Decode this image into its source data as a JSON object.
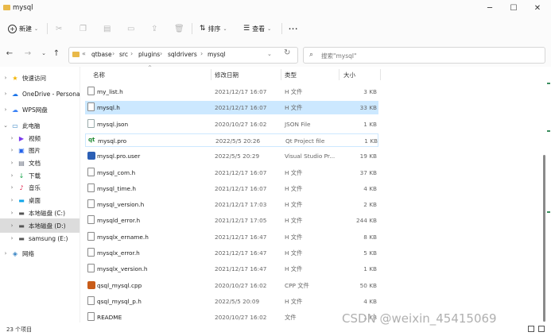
{
  "window": {
    "title": "mysql",
    "controls": [
      "─",
      "☐",
      "✕"
    ]
  },
  "toolbar": {
    "new_label": "新建",
    "sort_label": "排序",
    "view_label": "查看",
    "more_label": "···"
  },
  "address": {
    "crumbs": [
      "qtbase",
      "src",
      "plugins",
      "sqldrivers",
      "mysql"
    ],
    "overflow": "«",
    "search_placeholder": "搜索\"mysql\""
  },
  "nav": [
    {
      "label": "快速访问",
      "icon": "star-icon",
      "chev": "›",
      "color": "#f2b400"
    },
    {
      "label": "OneDrive - Persona",
      "icon": "cloud-icon",
      "chev": "›",
      "color": "#1a73e8"
    },
    {
      "label": "WPS网盘",
      "icon": "cloud-icon",
      "chev": "›",
      "color": "#3b82f6"
    },
    {
      "label": "此电脑",
      "icon": "computer-icon",
      "chev": "⌄",
      "color": "#2f7fc1"
    },
    {
      "label": "视频",
      "icon": "video-icon",
      "chev": "›",
      "color": "#7c3aed"
    },
    {
      "label": "图片",
      "icon": "picture-icon",
      "chev": "›",
      "color": "#2563eb"
    },
    {
      "label": "文档",
      "icon": "document-icon",
      "chev": "›",
      "color": "#6b7280"
    },
    {
      "label": "下载",
      "icon": "download-icon",
      "chev": "›",
      "color": "#16a34a"
    },
    {
      "label": "音乐",
      "icon": "music-icon",
      "chev": "›",
      "color": "#e11d48"
    },
    {
      "label": "桌面",
      "icon": "desktop-icon",
      "chev": "›",
      "color": "#0ea5e9"
    },
    {
      "label": "本地磁盘 (C:)",
      "icon": "drive-icon",
      "chev": "›",
      "color": "#555555"
    },
    {
      "label": "本地磁盘 (D:)",
      "icon": "drive-icon",
      "chev": "›",
      "color": "#555555"
    },
    {
      "label": "samsung (E:)",
      "icon": "drive-icon",
      "chev": "›",
      "color": "#555555"
    },
    {
      "label": "网络",
      "icon": "network-icon",
      "chev": "›",
      "color": "#2f7fc1"
    }
  ],
  "columns": {
    "name": "名称",
    "date": "修改日期",
    "type": "类型",
    "size": "大小"
  },
  "files": [
    {
      "name": "my_list.h",
      "date": "2021/12/17 16:07",
      "type": "H 文件",
      "size": "3 KB",
      "icon": "file-icon"
    },
    {
      "name": "mysql.h",
      "date": "2021/12/17 16:07",
      "type": "H 文件",
      "size": "33 KB",
      "icon": "file-icon"
    },
    {
      "name": "mysql.json",
      "date": "2020/10/27 16:02",
      "type": "JSON File",
      "size": "1 KB",
      "icon": "json-file-icon"
    },
    {
      "name": "mysql.pro",
      "date": "2022/5/5 20:26",
      "type": "Qt Project file",
      "size": "1 KB",
      "icon": "qt-project-icon"
    },
    {
      "name": "mysql.pro.user",
      "date": "2022/5/5 20:29",
      "type": "Visual Studio Pr...",
      "size": "19 KB",
      "icon": "visual-studio-icon"
    },
    {
      "name": "mysql_com.h",
      "date": "2021/12/17 16:07",
      "type": "H 文件",
      "size": "37 KB",
      "icon": "file-icon"
    },
    {
      "name": "mysql_time.h",
      "date": "2021/12/17 16:07",
      "type": "H 文件",
      "size": "4 KB",
      "icon": "file-icon"
    },
    {
      "name": "mysql_version.h",
      "date": "2021/12/17 17:03",
      "type": "H 文件",
      "size": "2 KB",
      "icon": "file-icon"
    },
    {
      "name": "mysqld_error.h",
      "date": "2021/12/17 17:05",
      "type": "H 文件",
      "size": "244 KB",
      "icon": "file-icon"
    },
    {
      "name": "mysqlx_ername.h",
      "date": "2021/12/17 16:47",
      "type": "H 文件",
      "size": "8 KB",
      "icon": "file-icon"
    },
    {
      "name": "mysqlx_error.h",
      "date": "2021/12/17 16:47",
      "type": "H 文件",
      "size": "5 KB",
      "icon": "file-icon"
    },
    {
      "name": "mysqlx_version.h",
      "date": "2021/12/17 16:47",
      "type": "H 文件",
      "size": "1 KB",
      "icon": "file-icon"
    },
    {
      "name": "qsql_mysql.cpp",
      "date": "2020/10/27 16:02",
      "type": "CPP 文件",
      "size": "50 KB",
      "icon": "cpp-file-icon"
    },
    {
      "name": "qsql_mysql_p.h",
      "date": "2022/5/5 20:09",
      "type": "H 文件",
      "size": "4 KB",
      "icon": "file-icon"
    },
    {
      "name": "README",
      "date": "2020/10/27 16:02",
      "type": "文件",
      "size": "1 KB",
      "icon": "file-icon"
    }
  ],
  "status": {
    "count": "23 个项目"
  },
  "watermark": "CSDN @weixin_45415069"
}
